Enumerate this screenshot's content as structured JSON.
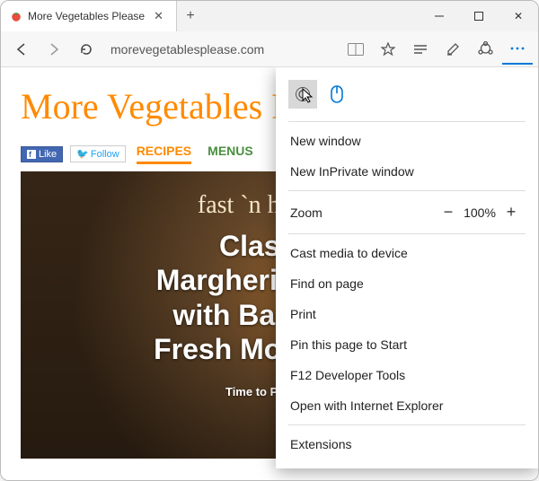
{
  "titlebar": {
    "tab_title": "More Vegetables Please"
  },
  "toolbar": {
    "address": "morevegetablesplease.com"
  },
  "page": {
    "site_title": "More Vegetables Please",
    "fb_label": "Like",
    "tw_label": "Follow",
    "nav": {
      "recipes": "RECIPES",
      "menus": "MENUS"
    },
    "hero_sub": "fast `n healthy",
    "hero_title_l1": "Classic",
    "hero_title_l2": "Margherita Pizza",
    "hero_title_l3": "with Basil and",
    "hero_title_l4": "Fresh Mozzarella",
    "hero_meta": "Time to Prepare"
  },
  "menu": {
    "new_window": "New window",
    "new_inprivate": "New InPrivate window",
    "zoom_label": "Zoom",
    "zoom_value": "100%",
    "cast": "Cast media to device",
    "find": "Find on page",
    "print": "Print",
    "pin": "Pin this page to Start",
    "devtools": "F12 Developer Tools",
    "open_ie": "Open with Internet Explorer",
    "extensions": "Extensions"
  }
}
